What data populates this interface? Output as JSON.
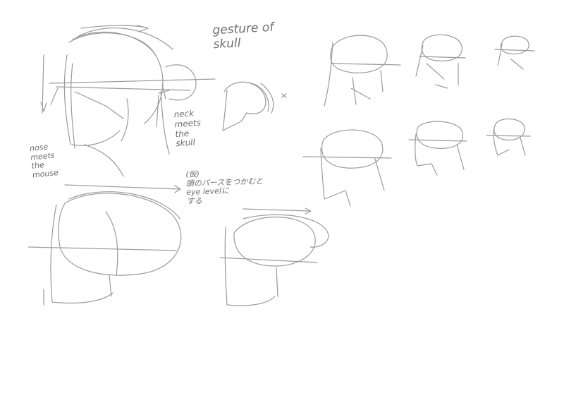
{
  "sketch": {
    "stroke_color": "#9a9a9a",
    "dark_stroke_color": "#6e6e6e",
    "background_color": "#ffffff",
    "notes": {
      "gesture": "gesture of\nskull",
      "neck": "neck\nmeets\nthe\nskull",
      "nose": "nose\nmeets\nthe\nmouse",
      "jp": "(仮)\n頭のパースをつかむと\neye levelに\nする"
    }
  }
}
